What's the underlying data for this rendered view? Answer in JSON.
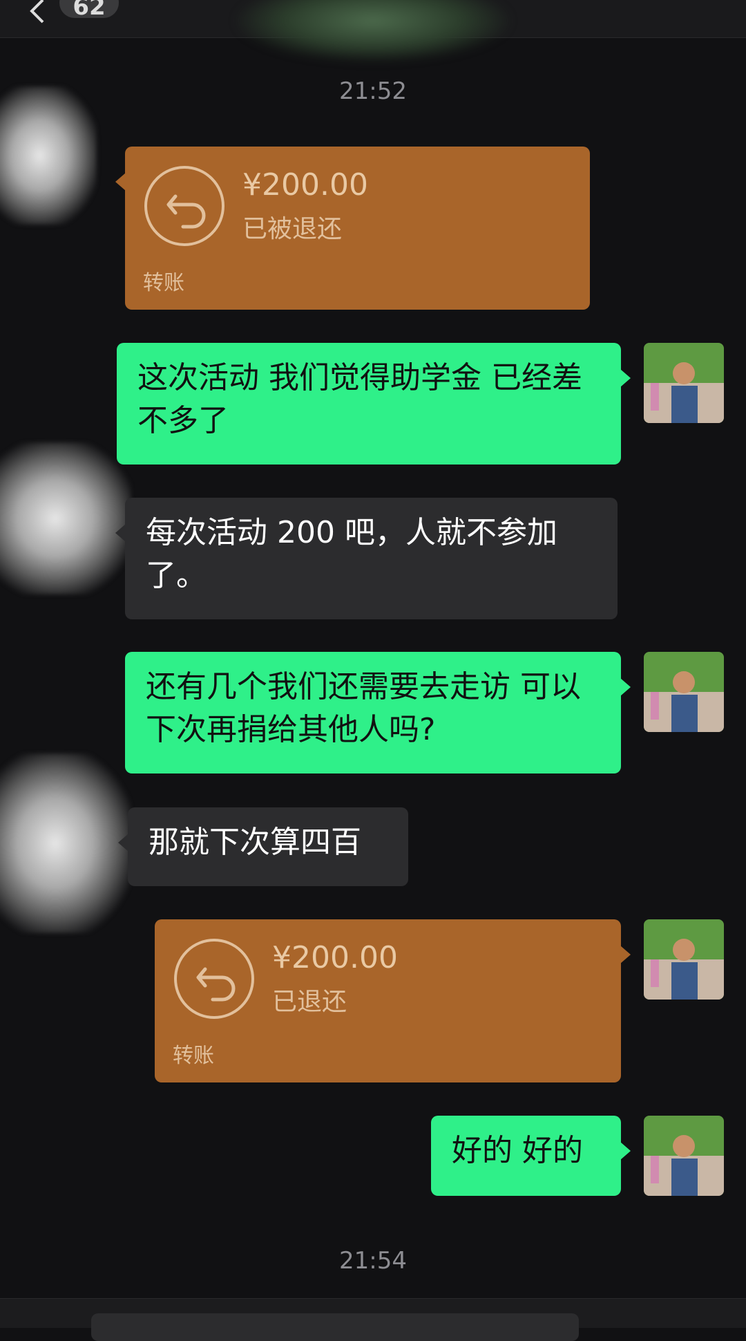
{
  "header": {
    "unread_count": "62"
  },
  "timestamps": [
    "21:52",
    "21:54"
  ],
  "messages": [
    {
      "type": "transfer",
      "sender": "them",
      "amount": "¥200.00",
      "status": "已被退还",
      "label": "转账"
    },
    {
      "type": "text",
      "sender": "me",
      "text": "这次活动 我们觉得助学金 已经差不多了"
    },
    {
      "type": "text",
      "sender": "them",
      "text": "每次活动 200 吧，人就不参加了。"
    },
    {
      "type": "text",
      "sender": "me",
      "text": "还有几个我们还需要去走访 可以下次再捐给其他人吗?"
    },
    {
      "type": "text",
      "sender": "them",
      "text": "那就下次算四百"
    },
    {
      "type": "transfer",
      "sender": "me",
      "amount": "¥200.00",
      "status": "已退还",
      "label": "转账"
    },
    {
      "type": "text",
      "sender": "me",
      "text": "好的 好的"
    }
  ],
  "colors": {
    "my_bubble": "#2ff089",
    "their_bubble": "#2c2c2e",
    "transfer_card": "#a9652a",
    "background": "#111113"
  },
  "icons": {
    "back": "chevron-left-icon",
    "refund": "refund-arrow-icon"
  }
}
